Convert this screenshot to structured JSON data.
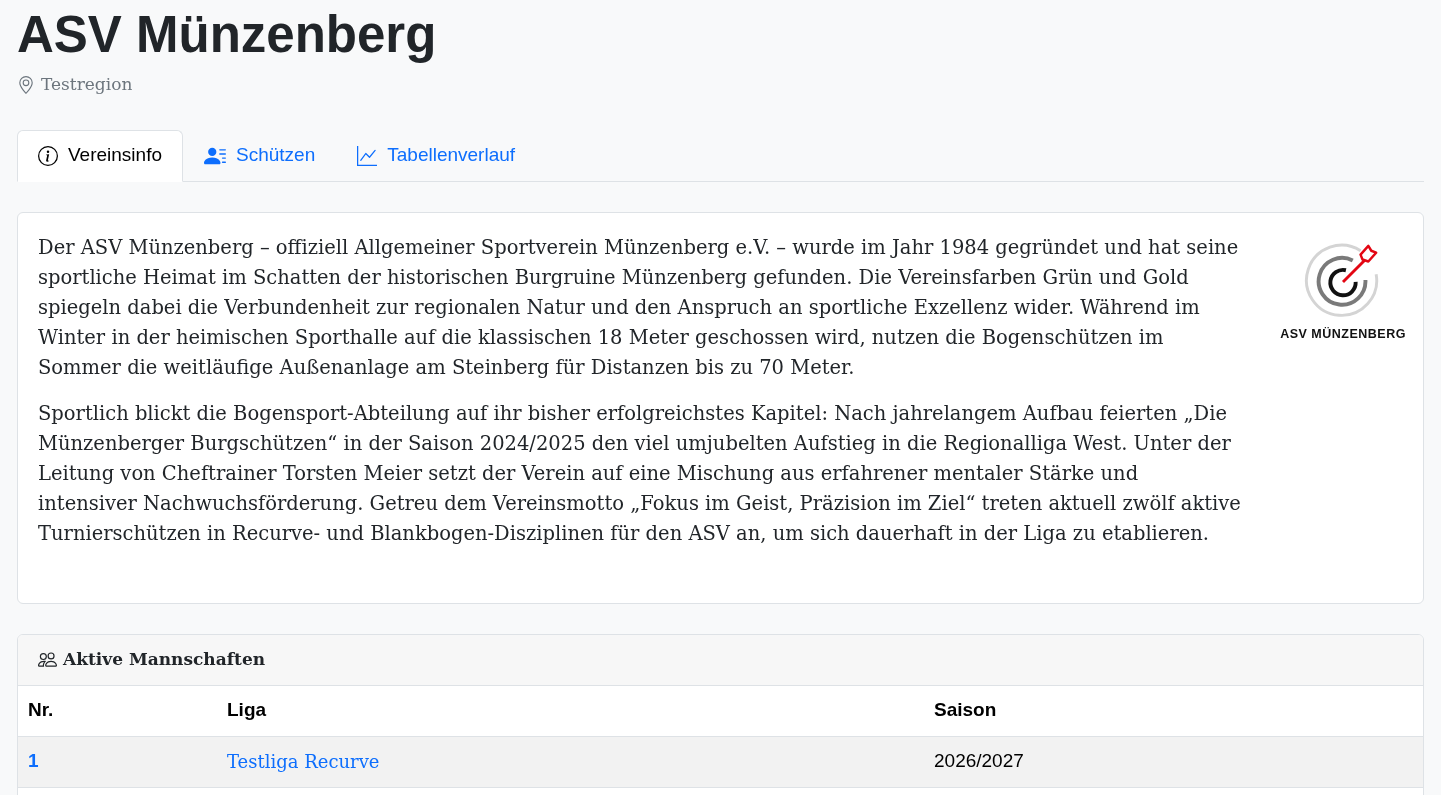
{
  "header": {
    "title": "ASV Münzenberg",
    "region": "Testregion"
  },
  "tabs": [
    {
      "label": "Vereinsinfo",
      "selected": true
    },
    {
      "label": "Schützen",
      "selected": false
    },
    {
      "label": "Tabellenverlauf",
      "selected": false
    }
  ],
  "info_card": {
    "paragraphs": [
      "Der ASV Münzenberg – offiziell Allgemeiner Sportverein Münzenberg e.V. – wurde im Jahr 1984 gegründet und hat seine sportliche Heimat im Schatten der historischen Burgruine Münzenberg gefunden. Die Vereinsfarben Grün und Gold spiegeln dabei die Verbundenheit zur regionalen Natur und den Anspruch an sportliche Exzellenz wider. Während im Winter in der heimischen Sporthalle auf die klassischen 18 Meter geschossen wird, nutzen die Bogenschützen im Sommer die weitläufige Außenanlage am Steinberg für Distanzen bis zu 70 Meter.",
      "Sportlich blickt die Bogensport-Abteilung auf ihr bisher erfolgreichstes Kapitel: Nach jahrelangem Aufbau feierten „Die Münzenberger Burgschützen“ in der Saison 2024/2025 den viel umjubelten Aufstieg in die Regionalliga West. Unter der Leitung von Cheftrainer Torsten Meier setzt der Verein auf eine Mischung aus erfahrener mentaler Stärke und intensiver Nachwuchsförderung. Getreu dem Vereinsmotto „Fokus im Geist, Präzision im Ziel“ treten aktuell zwölf aktive Turnierschützen in Recurve- und Blankbogen-Disziplinen für den ASV an, um sich dauerhaft in der Liga zu etablieren."
    ],
    "logo": {
      "text": "ASV MÜNZENBERG"
    }
  },
  "teams_card": {
    "title": "Aktive Mannschaften",
    "columns": [
      "Nr.",
      "Liga",
      "Saison"
    ],
    "rows": [
      {
        "nr": "1",
        "league": "Testliga Recurve",
        "season": "2026/2027"
      }
    ]
  }
}
